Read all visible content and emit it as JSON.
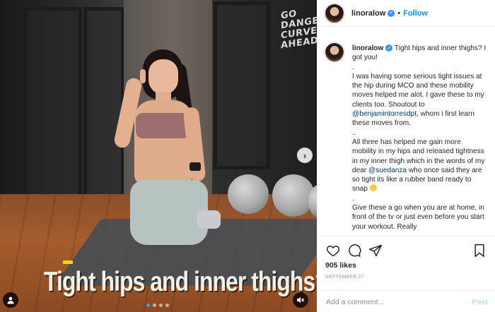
{
  "post": {
    "username": "linoralow",
    "follow_label": "Follow",
    "separator": "•",
    "likes": "905 likes",
    "date": "SEPTEMBER 27",
    "caption_lines": [
      " Tight hips and inner thighs? I got you!",
      ".",
      "I was having some serious tight issues at the hip during MCO and these mobility moves helped me alot. I gave these to my clients too. Shoutout to ",
      ", whom i first learn these moves from.",
      "..",
      "All three has helped me gain more mobility in my hips and released tightness in my inner thigh which in the words of my dear ",
      " who once said they are so tight its like a rubber band ready to snap ",
      ".",
      "Give these a go when you are at home, in front of the tv or just even before you start your workout. Really"
    ],
    "mentions": [
      "@benjamintorresdpt",
      "@suedanza"
    ],
    "comment_placeholder": "Add a comment...",
    "post_label": "Post"
  },
  "media": {
    "caption_text": "Tight hips and inner thighs?",
    "poster_lines": [
      "GO",
      "DANGE",
      "CURVES",
      "AHEAD."
    ],
    "next_arrow": "›",
    "carousel": {
      "count": 4,
      "active": 0
    }
  },
  "icons": {
    "like": "heart-icon",
    "comment": "comment-icon",
    "share": "share-icon",
    "save": "bookmark-icon",
    "verified": "verified-badge-icon",
    "user_tag": "user-tag-icon",
    "mute": "speaker-muted-icon"
  },
  "colors": {
    "link": "#0095f6",
    "mention": "#00376b",
    "verified": "#3897f0",
    "muted_text": "#8e8e8e"
  }
}
